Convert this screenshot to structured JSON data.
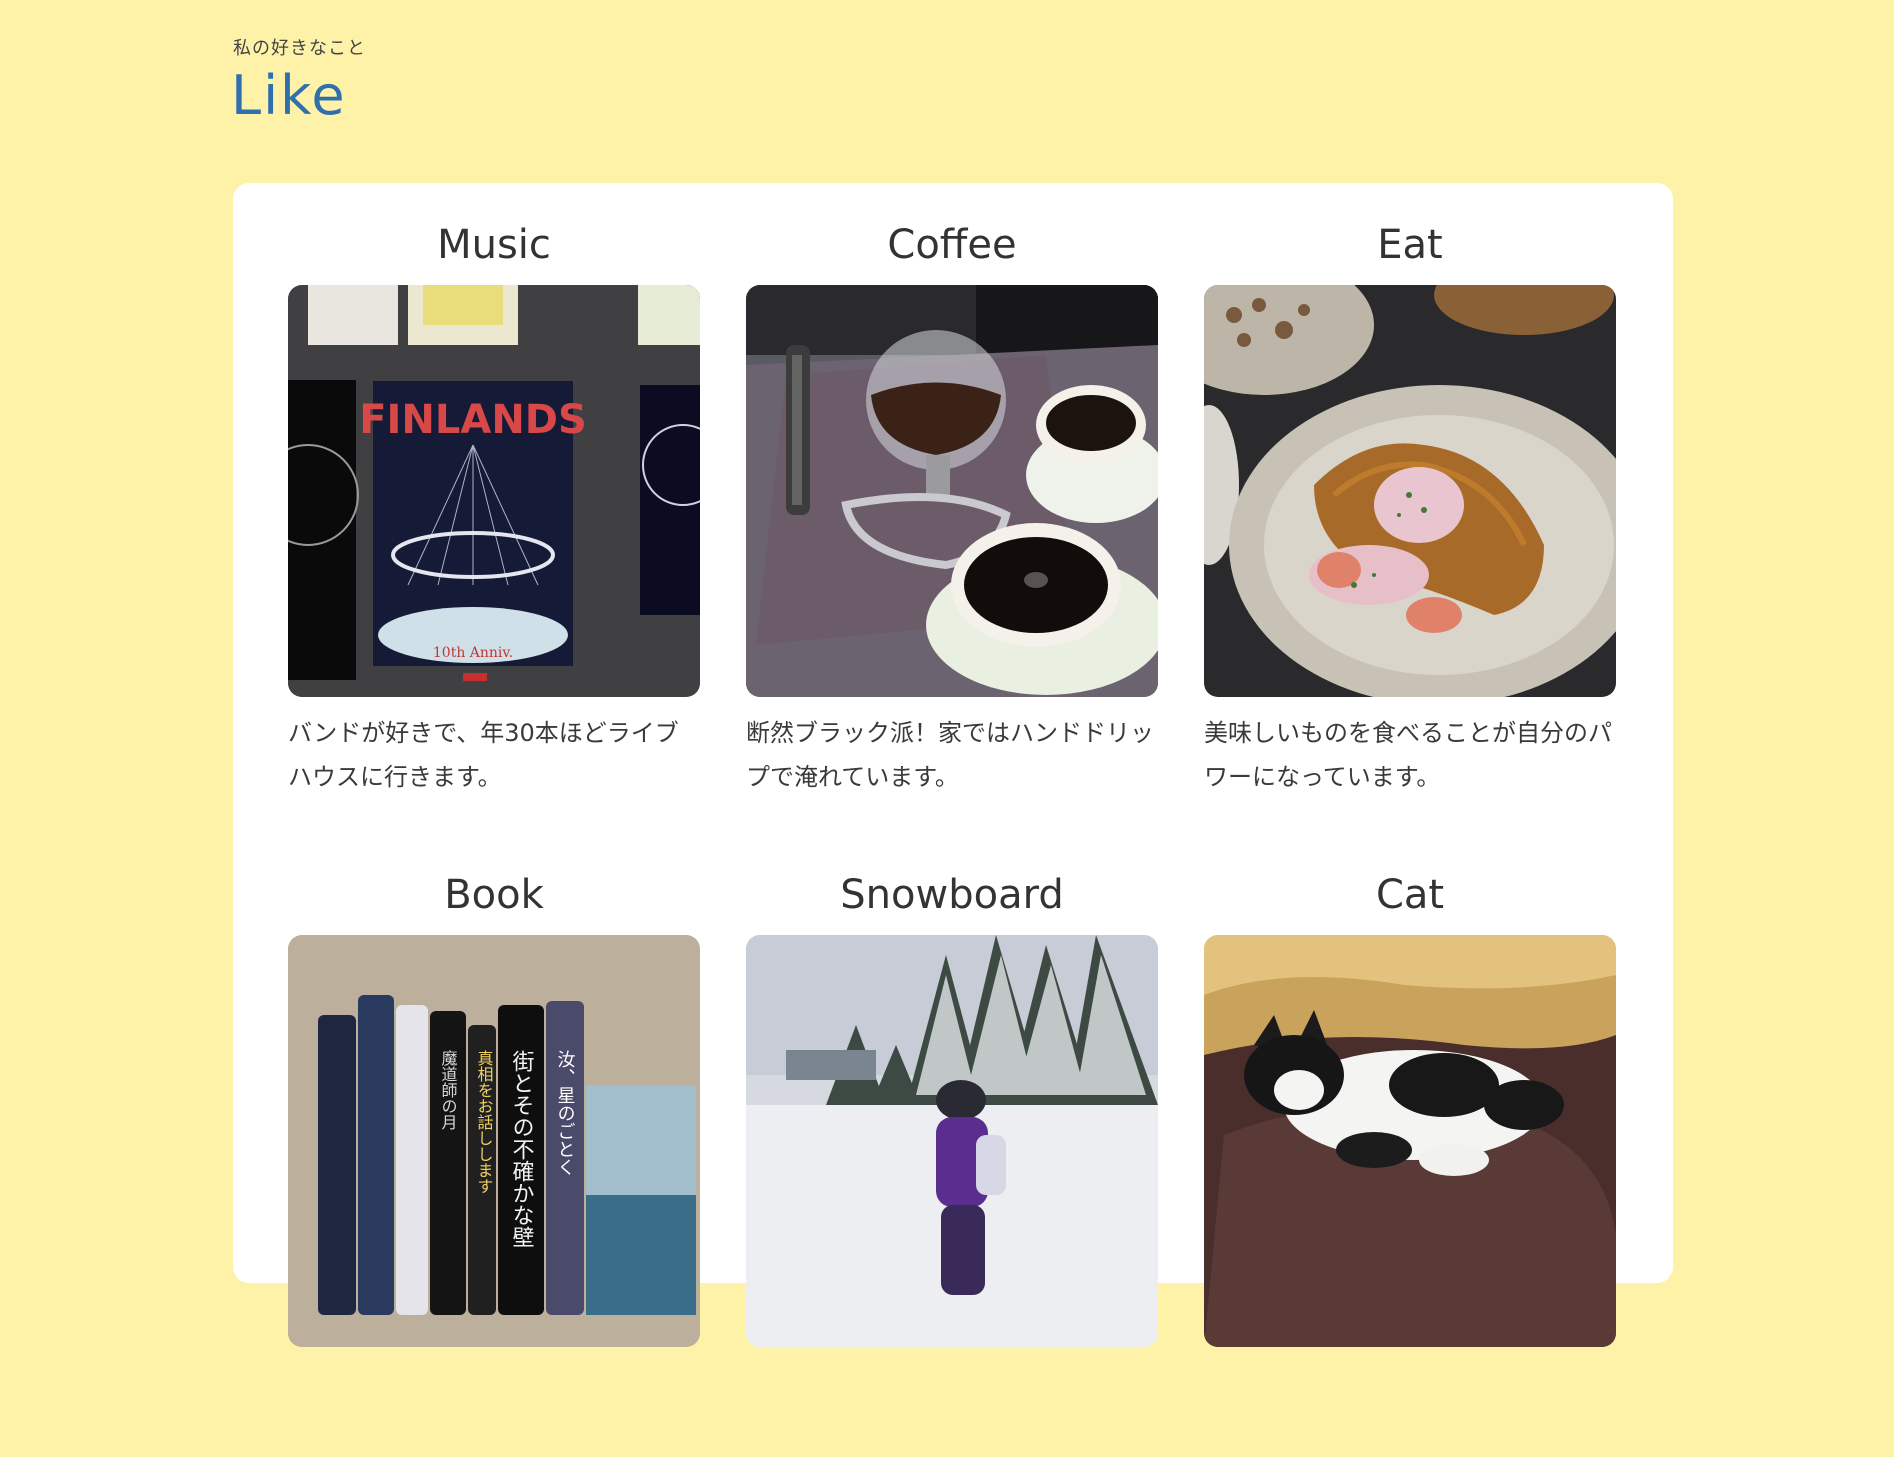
{
  "header": {
    "subtitle": "私の好きなこと",
    "title": "Like"
  },
  "items": [
    {
      "title": "Music",
      "text": "バンドが好きで、年30本ほどライブハウスに行きます。",
      "photo_icon": "concert-poster-photo",
      "poster_text": "FINLANDS",
      "poster_subtext": "10th Anniv."
    },
    {
      "title": "Coffee",
      "text": "断然ブラック派！家ではハンドドリップで淹れています。",
      "photo_icon": "coffee-siphon-photo"
    },
    {
      "title": "Eat",
      "text": "美味しいものを食べることが自分のパワーになっています。",
      "photo_icon": "fried-fish-plate-photo"
    },
    {
      "title": "Book",
      "text": "",
      "photo_icon": "books-stack-photo"
    },
    {
      "title": "Snowboard",
      "text": "",
      "photo_icon": "snowboard-slope-photo"
    },
    {
      "title": "Cat",
      "text": "",
      "photo_icon": "sleeping-cat-photo"
    }
  ],
  "colors": {
    "background": "#fdf2a8",
    "accent": "#2f6fae",
    "card": "#ffffff"
  }
}
